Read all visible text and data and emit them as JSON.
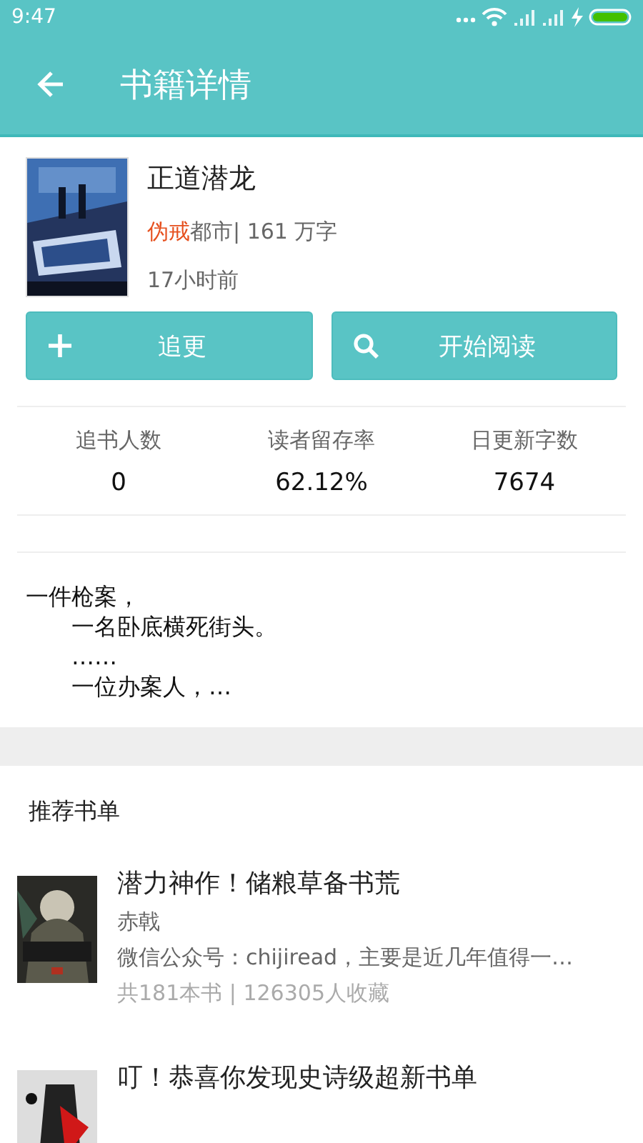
{
  "status_bar": {
    "time": "9:47"
  },
  "app_bar": {
    "title": "书籍详情"
  },
  "book": {
    "title": "正道潜龙",
    "author": "伪戒",
    "info": "都市| 161 万字",
    "updated": "17小时前"
  },
  "actions": [
    {
      "kind": "add",
      "label": "追更"
    },
    {
      "kind": "search",
      "label": "开始阅读"
    }
  ],
  "stats": [
    {
      "label": "追书人数",
      "value": "0"
    },
    {
      "label": "读者留存率",
      "value": "62.12%"
    },
    {
      "label": "日更新字数",
      "value": "7674"
    }
  ],
  "blurb": [
    "一件枪案，",
    "　　一名卧底横死街头。",
    "　　……",
    "　　一位办案人，…"
  ],
  "recommend": {
    "heading": "推荐书单",
    "lists": [
      {
        "title": "潜力神作！储粮草备书荒",
        "author": "赤戟",
        "description": "微信公众号：chijiread，主要是近几年值得一…",
        "meta": "共181本书 | 126305人收藏"
      },
      {
        "title": "叮！恭喜你发现史诗级超新书单"
      }
    ]
  }
}
